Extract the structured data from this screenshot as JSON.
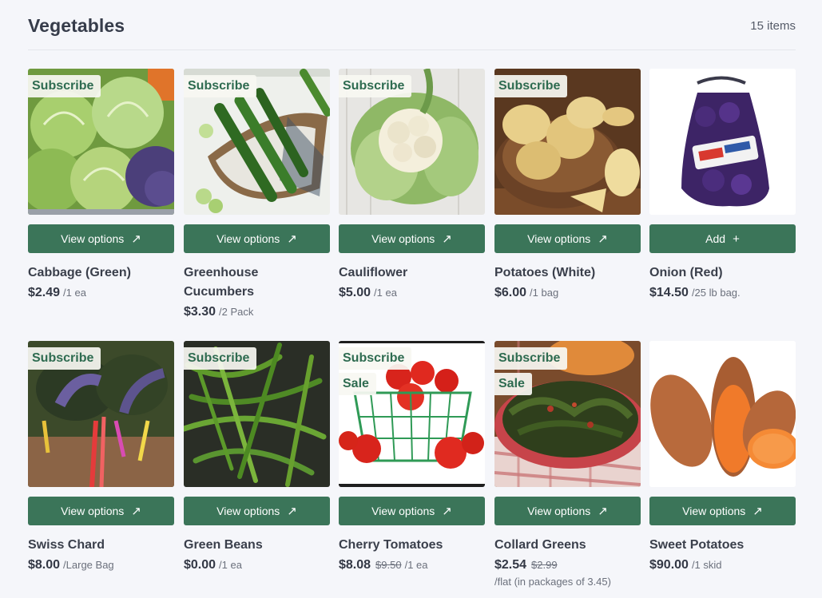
{
  "header": {
    "title": "Vegetables",
    "count": "15 items"
  },
  "colors": {
    "accent": "#3b7559",
    "badge_text": "#2e6b50",
    "background": "#f5f6fa"
  },
  "products": [
    {
      "name": "Cabbage (Green)",
      "price": "$2.49",
      "unit": "/1 ea",
      "badges": [
        "Subscribe"
      ],
      "button": "View options",
      "button_icon": "external-arrow-icon"
    },
    {
      "name": "Greenhouse Cucumbers",
      "price": "$3.30",
      "unit": "/2 Pack",
      "badges": [
        "Subscribe"
      ],
      "button": "View options",
      "button_icon": "external-arrow-icon"
    },
    {
      "name": "Cauliflower",
      "price": "$5.00",
      "unit": "/1 ea",
      "badges": [
        "Subscribe"
      ],
      "button": "View options",
      "button_icon": "external-arrow-icon"
    },
    {
      "name": "Potatoes (White)",
      "price": "$6.00",
      "unit": "/1 bag",
      "badges": [
        "Subscribe"
      ],
      "button": "View options",
      "button_icon": "external-arrow-icon"
    },
    {
      "name": "Onion (Red)",
      "price": "$14.50",
      "unit": "/25 lb bag.",
      "badges": [],
      "button": "Add",
      "button_icon": "plus-icon"
    },
    {
      "name": "Swiss Chard",
      "price": "$8.00",
      "unit": "/Large Bag",
      "badges": [
        "Subscribe"
      ],
      "button": "View options",
      "button_icon": "external-arrow-icon"
    },
    {
      "name": "Green Beans",
      "price": "$0.00",
      "unit": "/1 ea",
      "badges": [
        "Subscribe"
      ],
      "button": "View options",
      "button_icon": "external-arrow-icon"
    },
    {
      "name": "Cherry Tomatoes",
      "price": "$8.08",
      "old_price": "$9.50",
      "unit": "/1 ea",
      "badges": [
        "Subscribe",
        "Sale"
      ],
      "button": "View options",
      "button_icon": "external-arrow-icon"
    },
    {
      "name": "Collard Greens",
      "price": "$2.54",
      "old_price": "$2.99",
      "note": "/flat (in packages of 3.45)",
      "badges": [
        "Subscribe",
        "Sale"
      ],
      "button": "View options",
      "button_icon": "external-arrow-icon"
    },
    {
      "name": "Sweet Potatoes",
      "price": "$90.00",
      "unit": "/1 skid",
      "badges": [],
      "button": "View options",
      "button_icon": "external-arrow-icon"
    }
  ]
}
